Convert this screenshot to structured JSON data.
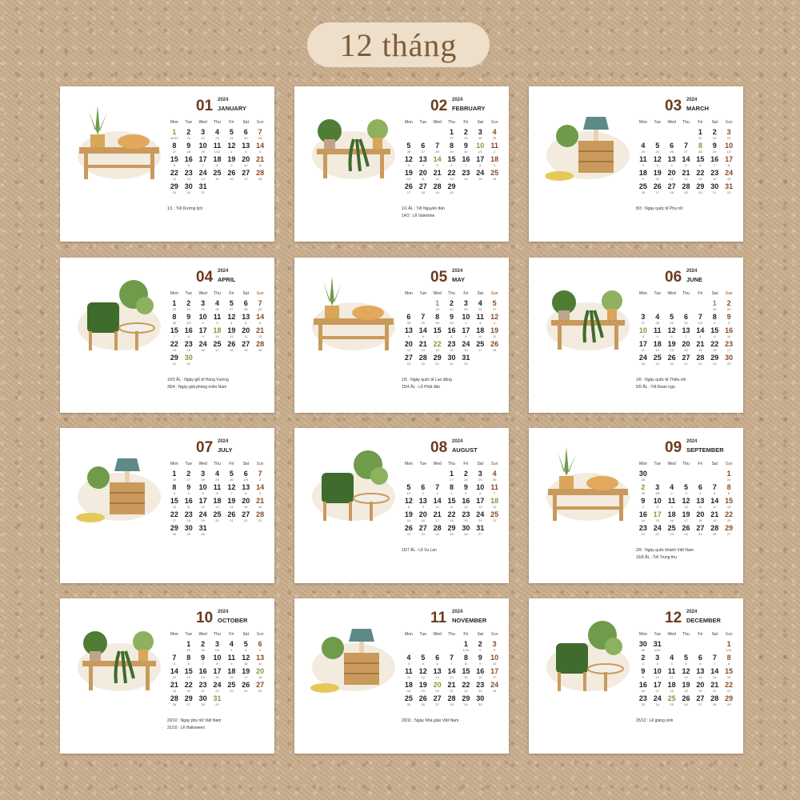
{
  "title": "12 tháng",
  "colors": {
    "background": "#c9ad8c",
    "pill": "#eddfca",
    "title": "#7d5c3a",
    "month_number": "#6b3a1c",
    "sunday": "#8a4a22",
    "holiday": "#7d9a3a",
    "card": "#ffffff"
  },
  "weekdays": [
    "Mon",
    "Tue",
    "Wed",
    "Thu",
    "Fri",
    "Sat",
    "Sun"
  ],
  "months": [
    {
      "num": "01",
      "year": "2024",
      "name": "JANUARY",
      "illustration": "plant-bench-with-sleeping-cat",
      "weeks": [
        [
          "1",
          "2",
          "3",
          "4",
          "5",
          "6",
          "7"
        ],
        [
          "8",
          "9",
          "10",
          "11",
          "12",
          "13",
          "14"
        ],
        [
          "15",
          "16",
          "17",
          "18",
          "19",
          "20",
          "21"
        ],
        [
          "22",
          "23",
          "24",
          "25",
          "26",
          "27",
          "28"
        ],
        [
          "29",
          "30",
          "31",
          "",
          "",
          "",
          ""
        ]
      ],
      "lunar": [
        [
          "20/11",
          "21",
          "22",
          "23",
          "24",
          "25",
          "26"
        ],
        [
          "27",
          "28",
          "29",
          "1/12",
          "2",
          "3",
          "4"
        ],
        [
          "5",
          "6",
          "7",
          "8",
          "9",
          "10",
          "11"
        ],
        [
          "12",
          "13",
          "14",
          "15",
          "16",
          "17",
          "18"
        ],
        [
          "19",
          "20",
          "21",
          "",
          "",
          "",
          ""
        ]
      ],
      "holidays": [
        "1/1 : Tết Dương lịch"
      ]
    },
    {
      "num": "02",
      "year": "2024",
      "name": "FEBRUARY",
      "illustration": "plant-shelf",
      "weeks": [
        [
          "",
          "",
          "",
          "1",
          "2",
          "3",
          "4"
        ],
        [
          "5",
          "6",
          "7",
          "8",
          "9",
          "10",
          "11"
        ],
        [
          "12",
          "13",
          "14",
          "15",
          "16",
          "17",
          "18"
        ],
        [
          "19",
          "20",
          "21",
          "22",
          "23",
          "24",
          "25"
        ],
        [
          "26",
          "27",
          "28",
          "29",
          "",
          "",
          ""
        ]
      ],
      "lunar": [
        [
          "",
          "",
          "",
          "22",
          "23",
          "24",
          "25"
        ],
        [
          "26",
          "27",
          "28",
          "29",
          "30",
          "1/1",
          "2"
        ],
        [
          "3",
          "4",
          "5",
          "6",
          "7",
          "8",
          "9"
        ],
        [
          "10",
          "11",
          "12",
          "13",
          "14",
          "15",
          "16"
        ],
        [
          "17",
          "18",
          "19",
          "20",
          "",
          "",
          ""
        ]
      ],
      "holidays": [
        "1/1 ÂL : Tết Nguyên đán",
        "14/2 : Lễ Valentine"
      ]
    },
    {
      "num": "03",
      "year": "2024",
      "name": "MARCH",
      "illustration": "lamp-dresser-and-dog",
      "weeks": [
        [
          "",
          "",
          "",
          "",
          "1",
          "2",
          "3"
        ],
        [
          "4",
          "5",
          "6",
          "7",
          "8",
          "9",
          "10"
        ],
        [
          "11",
          "12",
          "13",
          "14",
          "15",
          "16",
          "17"
        ],
        [
          "18",
          "19",
          "20",
          "21",
          "22",
          "23",
          "24"
        ],
        [
          "25",
          "26",
          "27",
          "28",
          "29",
          "30",
          "31"
        ]
      ],
      "lunar": [
        [
          "",
          "",
          "",
          "",
          "21",
          "22",
          "23"
        ],
        [
          "24",
          "25",
          "26",
          "27",
          "28",
          "29",
          "1/2"
        ],
        [
          "2",
          "3",
          "4",
          "5",
          "6",
          "7",
          "8"
        ],
        [
          "9",
          "10",
          "11",
          "12",
          "13",
          "14",
          "15"
        ],
        [
          "16",
          "17",
          "18",
          "19",
          "20",
          "21",
          "22"
        ]
      ],
      "holidays": [
        "8/3 : Ngày quốc tế Phụ nữ"
      ]
    },
    {
      "num": "04",
      "year": "2024",
      "name": "APRIL",
      "illustration": "armchair-and-monstera",
      "weeks": [
        [
          "1",
          "2",
          "3",
          "4",
          "5",
          "6",
          "7"
        ],
        [
          "8",
          "9",
          "10",
          "11",
          "12",
          "13",
          "14"
        ],
        [
          "15",
          "16",
          "17",
          "18",
          "19",
          "20",
          "21"
        ],
        [
          "22",
          "23",
          "24",
          "25",
          "26",
          "27",
          "28"
        ],
        [
          "29",
          "30",
          "",
          "",
          "",
          "",
          ""
        ]
      ],
      "lunar": [
        [
          "23",
          "24",
          "25",
          "26",
          "27",
          "28",
          "29"
        ],
        [
          "30",
          "1/3",
          "2",
          "3",
          "4",
          "5",
          "6"
        ],
        [
          "7",
          "8",
          "9",
          "10",
          "11",
          "12",
          "13"
        ],
        [
          "14",
          "15",
          "16",
          "17",
          "18",
          "19",
          "20"
        ],
        [
          "21",
          "22",
          "",
          "",
          "",
          "",
          ""
        ]
      ],
      "holidays": [
        "10/3 ÂL : Ngày giỗ tổ Hùng Vương",
        "30/4 : Ngày giải phóng miền Nam"
      ]
    },
    {
      "num": "05",
      "year": "2024",
      "name": "MAY",
      "illustration": "lamp-and-side-table",
      "weeks": [
        [
          "",
          "",
          "1",
          "2",
          "3",
          "4",
          "5"
        ],
        [
          "6",
          "7",
          "8",
          "9",
          "10",
          "11",
          "12"
        ],
        [
          "13",
          "14",
          "15",
          "16",
          "17",
          "18",
          "19"
        ],
        [
          "20",
          "21",
          "22",
          "23",
          "24",
          "25",
          "26"
        ],
        [
          "27",
          "28",
          "29",
          "30",
          "31",
          "",
          ""
        ]
      ],
      "lunar": [
        [
          "",
          "",
          "23",
          "24",
          "25",
          "26",
          "27"
        ],
        [
          "28",
          "29",
          "30",
          "1/4",
          "2",
          "3",
          "4"
        ],
        [
          "5",
          "6",
          "7",
          "8",
          "9",
          "10",
          "11"
        ],
        [
          "12",
          "13",
          "14",
          "15",
          "16",
          "17",
          "18"
        ],
        [
          "19",
          "20",
          "21",
          "22",
          "23",
          "",
          ""
        ]
      ],
      "holidays": [
        "1/5 : Ngày quốc tế Lao động",
        "15/4 ÂL : Lễ Phật đản"
      ]
    },
    {
      "num": "06",
      "year": "2024",
      "name": "JUNE",
      "illustration": "rattan-console-with-plants",
      "weeks": [
        [
          "",
          "",
          "",
          "",
          "",
          "1",
          "2"
        ],
        [
          "3",
          "4",
          "5",
          "6",
          "7",
          "8",
          "9"
        ],
        [
          "10",
          "11",
          "12",
          "13",
          "14",
          "15",
          "16"
        ],
        [
          "17",
          "18",
          "19",
          "20",
          "21",
          "22",
          "23"
        ],
        [
          "24",
          "25",
          "26",
          "27",
          "28",
          "29",
          "30"
        ]
      ],
      "lunar": [
        [
          "",
          "",
          "",
          "",
          "",
          "25",
          "26"
        ],
        [
          "27",
          "28",
          "29",
          "30",
          "1/5",
          "2",
          "3"
        ],
        [
          "4",
          "5",
          "6",
          "7",
          "8",
          "9",
          "10"
        ],
        [
          "11",
          "12",
          "13",
          "14",
          "15",
          "16",
          "17"
        ],
        [
          "18",
          "19",
          "20",
          "21",
          "22",
          "23",
          "24"
        ]
      ],
      "holidays": [
        "1/6 : Ngày quốc tế Thiếu nhi",
        "5/5 ÂL : Tết Đoan ngọ"
      ]
    },
    {
      "num": "07",
      "year": "2024",
      "name": "JULY",
      "illustration": "reading-corner",
      "weeks": [
        [
          "1",
          "2",
          "3",
          "4",
          "5",
          "6",
          "7"
        ],
        [
          "8",
          "9",
          "10",
          "11",
          "12",
          "13",
          "14"
        ],
        [
          "15",
          "16",
          "17",
          "18",
          "19",
          "20",
          "21"
        ],
        [
          "22",
          "23",
          "24",
          "25",
          "26",
          "27",
          "28"
        ],
        [
          "29",
          "30",
          "31",
          "",
          "",
          "",
          ""
        ]
      ],
      "lunar": [
        [
          "26",
          "27",
          "28",
          "29",
          "30",
          "1/6",
          "2"
        ],
        [
          "3",
          "4",
          "5",
          "6",
          "7",
          "8",
          "9"
        ],
        [
          "10",
          "11",
          "12",
          "13",
          "14",
          "15",
          "16"
        ],
        [
          "17",
          "18",
          "19",
          "20",
          "21",
          "22",
          "23"
        ],
        [
          "24",
          "25",
          "26",
          "",
          "",
          "",
          ""
        ]
      ],
      "holidays": []
    },
    {
      "num": "08",
      "year": "2024",
      "name": "AUGUST",
      "illustration": "living-room-rug",
      "weeks": [
        [
          "",
          "",
          "",
          "1",
          "2",
          "3",
          "4"
        ],
        [
          "5",
          "6",
          "7",
          "8",
          "9",
          "10",
          "11"
        ],
        [
          "12",
          "13",
          "14",
          "15",
          "16",
          "17",
          "18"
        ],
        [
          "19",
          "20",
          "21",
          "22",
          "23",
          "24",
          "25"
        ],
        [
          "26",
          "27",
          "28",
          "29",
          "30",
          "31",
          ""
        ]
      ],
      "lunar": [
        [
          "",
          "",
          "",
          "27",
          "28",
          "29",
          "30"
        ],
        [
          "1/7",
          "2",
          "3",
          "4",
          "5",
          "6",
          "7"
        ],
        [
          "8",
          "9",
          "10",
          "11",
          "12",
          "13",
          "14"
        ],
        [
          "15",
          "16",
          "17",
          "18",
          "19",
          "20",
          "21"
        ],
        [
          "22",
          "23",
          "24",
          "25",
          "26",
          "27",
          ""
        ]
      ],
      "holidays": [
        "15/7 ÂL : Lễ Vu Lan"
      ]
    },
    {
      "num": "09",
      "year": "2024",
      "name": "SEPTEMBER",
      "illustration": "cactus-dresser-and-chair",
      "weeks": [
        [
          "30",
          "",
          "",
          "",
          "",
          "",
          "1"
        ],
        [
          "2",
          "3",
          "4",
          "5",
          "6",
          "7",
          "8"
        ],
        [
          "9",
          "10",
          "11",
          "12",
          "13",
          "14",
          "15"
        ],
        [
          "16",
          "17",
          "18",
          "19",
          "20",
          "21",
          "22"
        ],
        [
          "23",
          "24",
          "25",
          "26",
          "27",
          "28",
          "29"
        ]
      ],
      "lunar": [
        [
          "28",
          "",
          "",
          "",
          "",
          "",
          "29"
        ],
        [
          "30",
          "1/8",
          "2",
          "3",
          "4",
          "5",
          "6"
        ],
        [
          "7",
          "8",
          "9",
          "10",
          "11",
          "12",
          "13"
        ],
        [
          "14",
          "15",
          "16",
          "17",
          "18",
          "19",
          "20"
        ],
        [
          "21",
          "22",
          "23",
          "24",
          "25",
          "26",
          "27"
        ]
      ],
      "holidays": [
        "2/9 : Ngày quốc khánh Việt Nam",
        "15/8 ÂL : Tết Trung thu"
      ]
    },
    {
      "num": "10",
      "year": "2024",
      "name": "OCTOBER",
      "illustration": "cozy-corner-with-frame",
      "weeks": [
        [
          "",
          "1",
          "2",
          "3",
          "4",
          "5",
          "6"
        ],
        [
          "7",
          "8",
          "9",
          "10",
          "11",
          "12",
          "13"
        ],
        [
          "14",
          "15",
          "16",
          "17",
          "18",
          "19",
          "20"
        ],
        [
          "21",
          "22",
          "23",
          "24",
          "25",
          "26",
          "27"
        ],
        [
          "28",
          "29",
          "30",
          "31",
          "",
          "",
          ""
        ]
      ],
      "lunar": [
        [
          "",
          "29",
          "30",
          "1/9",
          "2",
          "3",
          "4"
        ],
        [
          "5",
          "6",
          "7",
          "8",
          "9",
          "10",
          "11"
        ],
        [
          "12",
          "13",
          "14",
          "15",
          "16",
          "17",
          "18"
        ],
        [
          "19",
          "20",
          "21",
          "22",
          "23",
          "24",
          "25"
        ],
        [
          "26",
          "27",
          "28",
          "29",
          "",
          "",
          ""
        ]
      ],
      "holidays": [
        "20/10 : Ngày phụ nữ Việt Nam",
        "31/10 : Lễ Halloween"
      ]
    },
    {
      "num": "11",
      "year": "2024",
      "name": "NOVEMBER",
      "illustration": "bench-and-shelf",
      "weeks": [
        [
          "",
          "",
          "",
          "",
          "1",
          "2",
          "3"
        ],
        [
          "4",
          "5",
          "6",
          "7",
          "8",
          "9",
          "10"
        ],
        [
          "11",
          "12",
          "13",
          "14",
          "15",
          "16",
          "17"
        ],
        [
          "18",
          "19",
          "20",
          "21",
          "22",
          "23",
          "24"
        ],
        [
          "25",
          "26",
          "27",
          "28",
          "29",
          "30",
          ""
        ]
      ],
      "lunar": [
        [
          "",
          "",
          "",
          "",
          "1/10",
          "2",
          "3"
        ],
        [
          "4",
          "5",
          "6",
          "7",
          "8",
          "9",
          "10"
        ],
        [
          "11",
          "12",
          "13",
          "14",
          "15",
          "16",
          "17"
        ],
        [
          "18",
          "19",
          "20",
          "21",
          "22",
          "23",
          "24"
        ],
        [
          "25",
          "26",
          "27",
          "28",
          "29",
          "30",
          ""
        ]
      ],
      "holidays": [
        "20/11 : Ngày Nhà giáo Việt Nam"
      ]
    },
    {
      "num": "12",
      "year": "2024",
      "name": "DECEMBER",
      "illustration": "plants-and-coffee-table",
      "weeks": [
        [
          "30",
          "31",
          "",
          "",
          "",
          "",
          "1"
        ],
        [
          "2",
          "3",
          "4",
          "5",
          "6",
          "7",
          "8"
        ],
        [
          "9",
          "10",
          "11",
          "12",
          "13",
          "14",
          "15"
        ],
        [
          "16",
          "17",
          "18",
          "19",
          "20",
          "21",
          "22"
        ],
        [
          "23",
          "24",
          "25",
          "26",
          "27",
          "28",
          "29"
        ]
      ],
      "lunar": [
        [
          "30",
          "1/12",
          "",
          "",
          "",
          "",
          "1/11"
        ],
        [
          "2",
          "3",
          "4",
          "5",
          "6",
          "7",
          "8"
        ],
        [
          "9",
          "10",
          "11",
          "12",
          "13",
          "14",
          "15"
        ],
        [
          "16",
          "17",
          "18",
          "19",
          "20",
          "21",
          "22"
        ],
        [
          "23",
          "24",
          "25",
          "26",
          "27",
          "28",
          "29"
        ]
      ],
      "holidays": [
        "25/12 : Lễ giáng sinh"
      ]
    }
  ],
  "highlights": {
    "0": [
      "1"
    ],
    "1": [
      "10",
      "14"
    ],
    "2": [
      "8"
    ],
    "3": [
      "18",
      "30"
    ],
    "4": [
      "1",
      "22"
    ],
    "5": [
      "1",
      "10"
    ],
    "7": [
      "18"
    ],
    "8": [
      "2",
      "17"
    ],
    "9": [
      "20",
      "31"
    ],
    "10": [
      "20"
    ],
    "11": [
      "25"
    ]
  }
}
